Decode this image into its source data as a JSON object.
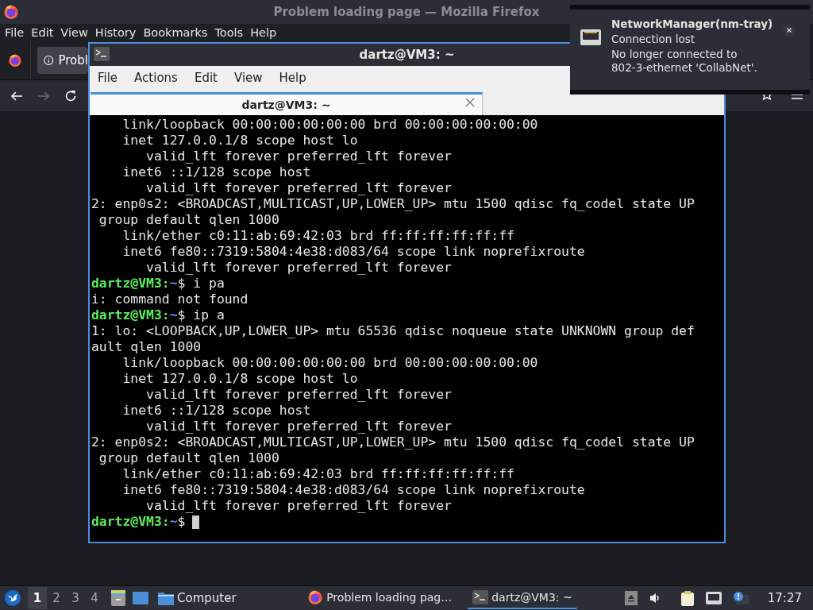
{
  "firefox": {
    "title": "Problem loading page — Mozilla Firefox",
    "menu": [
      "File",
      "Edit",
      "View",
      "History",
      "Bookmarks",
      "Tools",
      "Help"
    ],
    "tab": {
      "label": "Probl"
    },
    "nav_buttons": [
      {
        "kind": "back",
        "disabled": false
      },
      {
        "kind": "forward",
        "disabled": true
      },
      {
        "kind": "reload",
        "disabled": false
      }
    ]
  },
  "terminal": {
    "title": "dartz@VM3: ~",
    "menu": [
      "File",
      "Actions",
      "Edit",
      "View",
      "Help"
    ],
    "tabs": [
      {
        "label": "dartz@VM3: ~",
        "selected": true
      }
    ],
    "lines": [
      {
        "kind": "output",
        "text": "    link/loopback 00:00:00:00:00:00 brd 00:00:00:00:00:00"
      },
      {
        "kind": "output",
        "text": "    inet 127.0.0.1/8 scope host lo"
      },
      {
        "kind": "output",
        "text": "       valid_lft forever preferred_lft forever"
      },
      {
        "kind": "output",
        "text": "    inet6 ::1/128 scope host"
      },
      {
        "kind": "output",
        "text": "       valid_lft forever preferred_lft forever"
      },
      {
        "kind": "output",
        "text": "2: enp0s2: <BROADCAST,MULTICAST,UP,LOWER_UP> mtu 1500 qdisc fq_codel state UP"
      },
      {
        "kind": "output",
        "text": " group default qlen 1000"
      },
      {
        "kind": "output",
        "text": "    link/ether c0:11:ab:69:42:03 brd ff:ff:ff:ff:ff:ff"
      },
      {
        "kind": "output",
        "text": "    inet6 fe80::7319:5804:4e38:d083/64 scope link noprefixroute"
      },
      {
        "kind": "output",
        "text": "       valid_lft forever preferred_lft forever"
      },
      {
        "kind": "prompt",
        "user": "dartz@VM3:",
        "path": "~",
        "command": "$ i pa"
      },
      {
        "kind": "output",
        "text": "i: command not found"
      },
      {
        "kind": "prompt",
        "user": "dartz@VM3:",
        "path": "~",
        "command": "$ ip a"
      },
      {
        "kind": "output",
        "text": "1: lo: <LOOPBACK,UP,LOWER_UP> mtu 65536 qdisc noqueue state UNKNOWN group def"
      },
      {
        "kind": "output",
        "text": "ault qlen 1000"
      },
      {
        "kind": "output",
        "text": "    link/loopback 00:00:00:00:00:00 brd 00:00:00:00:00:00"
      },
      {
        "kind": "output",
        "text": "    inet 127.0.0.1/8 scope host lo"
      },
      {
        "kind": "output",
        "text": "       valid_lft forever preferred_lft forever"
      },
      {
        "kind": "output",
        "text": "    inet6 ::1/128 scope host"
      },
      {
        "kind": "output",
        "text": "       valid_lft forever preferred_lft forever"
      },
      {
        "kind": "output",
        "text": "2: enp0s2: <BROADCAST,MULTICAST,UP,LOWER_UP> mtu 1500 qdisc fq_codel state UP"
      },
      {
        "kind": "output",
        "text": " group default qlen 1000"
      },
      {
        "kind": "output",
        "text": "    link/ether c0:11:ab:69:42:03 brd ff:ff:ff:ff:ff:ff"
      },
      {
        "kind": "output",
        "text": "    inet6 fe80::7319:5804:4e38:d083/64 scope link noprefixroute"
      },
      {
        "kind": "output",
        "text": "       valid_lft forever preferred_lft forever"
      },
      {
        "kind": "prompt",
        "user": "dartz@VM3:",
        "path": "~",
        "command": "$",
        "cursor": true
      }
    ]
  },
  "notification": {
    "app": "NetworkManager(nm-tray)",
    "summary": "Connection lost",
    "body_lines": [
      "No longer connected to",
      "802-3-ethernet 'CollabNet'."
    ]
  },
  "taskbar": {
    "workspaces": [
      {
        "label": "1",
        "selected": true
      },
      {
        "label": "2",
        "selected": false
      },
      {
        "label": "3",
        "selected": false
      },
      {
        "label": "4",
        "selected": false
      }
    ],
    "places": [
      {
        "label": "Computer"
      }
    ],
    "tasks": [
      {
        "kind": "browser",
        "label": "Problem loading pag…",
        "selected": false
      },
      {
        "kind": "terminal",
        "label": "dartz@VM3: ~",
        "selected": true
      }
    ],
    "clock": "17:27"
  }
}
